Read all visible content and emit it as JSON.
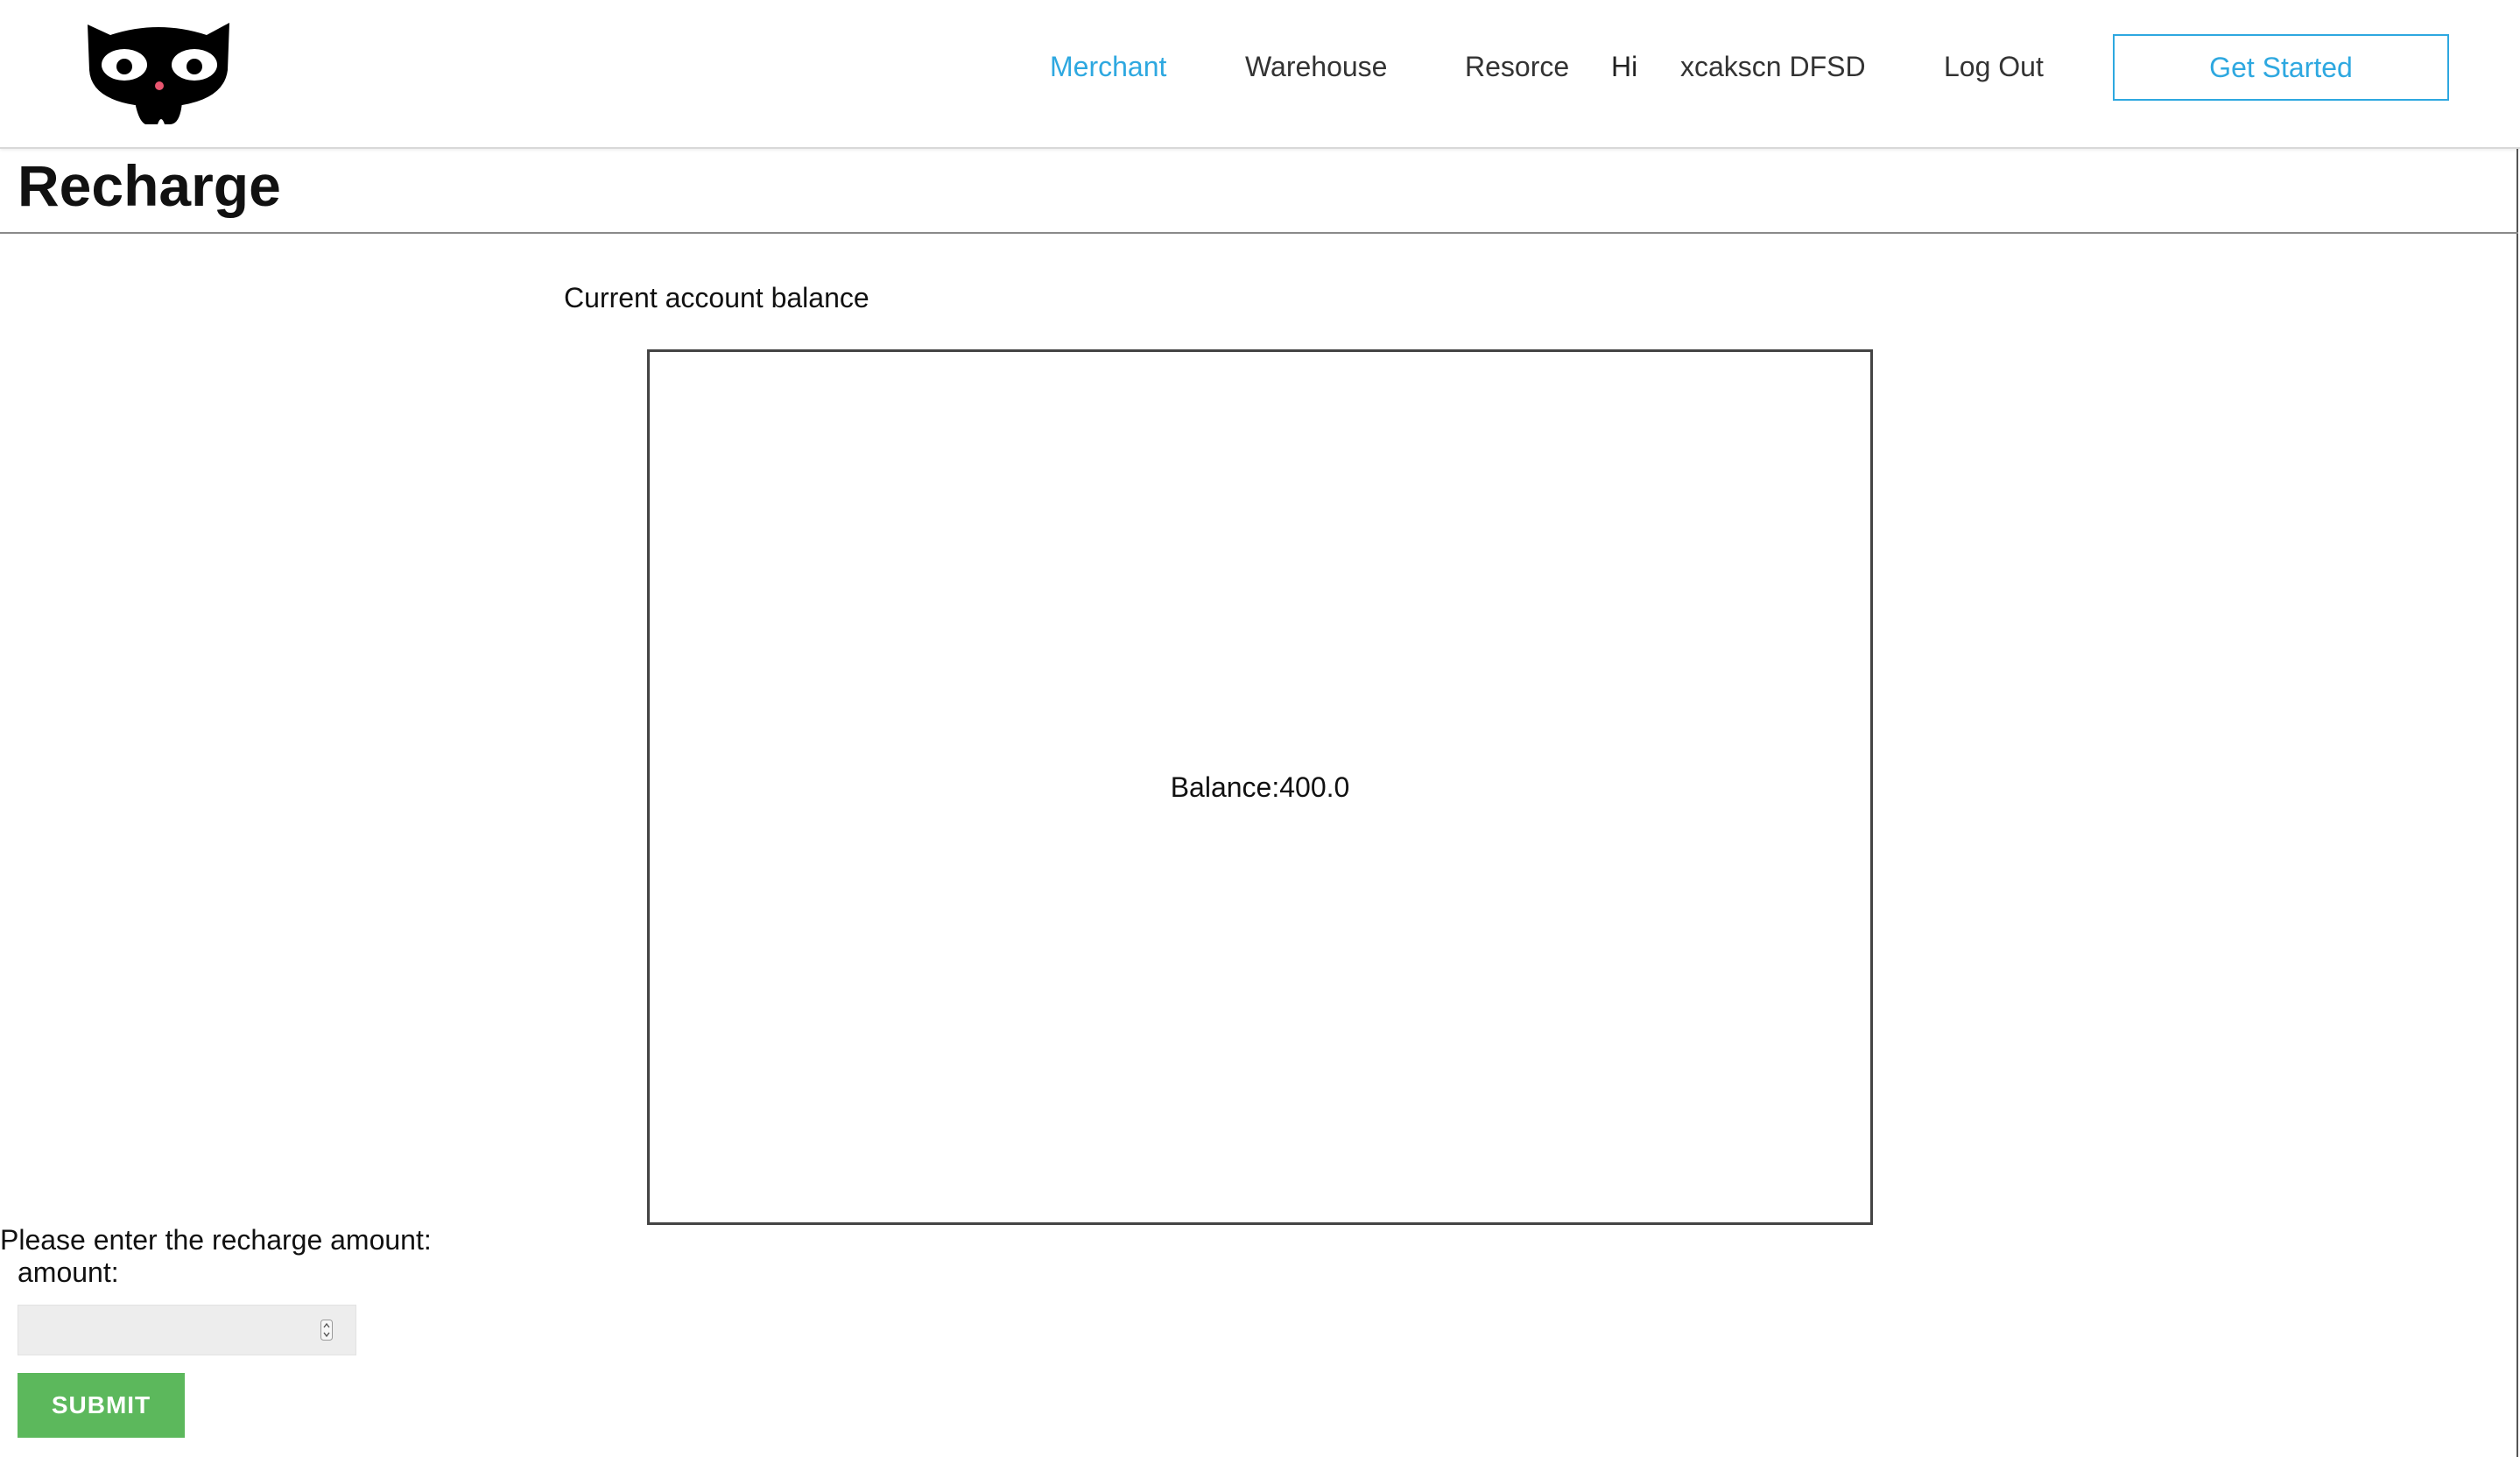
{
  "nav": {
    "logo_icon": "black-cat-logo",
    "links": [
      {
        "label": "Merchant",
        "active": true
      },
      {
        "label": "Warehouse",
        "active": false
      },
      {
        "label": "Resorce",
        "active": false
      }
    ],
    "greeting": "Hi",
    "username": "xcakscn DFSD",
    "logout_label": "Log Out",
    "cta_label": "Get Started",
    "accent_color": "#2ea8e0"
  },
  "page": {
    "title": "Recharge"
  },
  "balance": {
    "section_label": "Current account balance",
    "text": "Balance:400.0"
  },
  "recharge_form": {
    "prompt": "Please enter the recharge amount:",
    "amount_label": "amount:",
    "amount_value": "",
    "submit_label": "SUBMIT",
    "submit_color": "#5cb85c"
  }
}
